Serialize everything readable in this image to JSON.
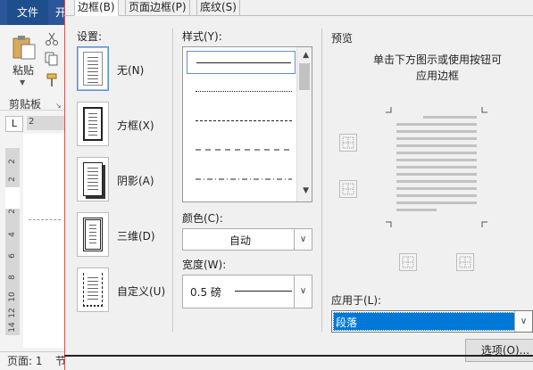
{
  "word": {
    "file_tab": "文件",
    "next_tab": "开",
    "paste_label": "粘贴",
    "clipboard_label": "剪贴板",
    "ruler_tab_symbol": "L",
    "h_ruler_number": "2",
    "v_ruler_numbers": [
      "2",
      "2",
      "2",
      "4",
      "6",
      "8",
      "10",
      "12",
      "14"
    ],
    "status_page": "页面: 1",
    "status_more": "节"
  },
  "dialog": {
    "tabs": [
      "边框(B)",
      "页面边框(P)",
      "底纹(S)"
    ],
    "active_tab": 0,
    "setting_label": "设置:",
    "settings": [
      "无(N)",
      "方框(X)",
      "阴影(A)",
      "三维(D)",
      "自定义(U)"
    ],
    "selected_setting": 0,
    "style_label": "样式(Y):",
    "styles": [
      "solid",
      "dotted",
      "dashed",
      "dashed-wide",
      "dash-dot"
    ],
    "selected_style": 0,
    "color_label": "颜色(C):",
    "color_value": "自动",
    "width_label": "宽度(W):",
    "width_value": "0.5 磅",
    "preview_label": "预览",
    "preview_hint_line1": "单击下方图示或使用按钮可",
    "preview_hint_line2": "应用边框",
    "apply_to_label": "应用于(L):",
    "apply_to_value": "段落",
    "options_button": "选项(O)...",
    "colors": {
      "accent": "#0078d7",
      "selection_border": "#5d8fcf",
      "word_blue": "#2b579a"
    }
  }
}
